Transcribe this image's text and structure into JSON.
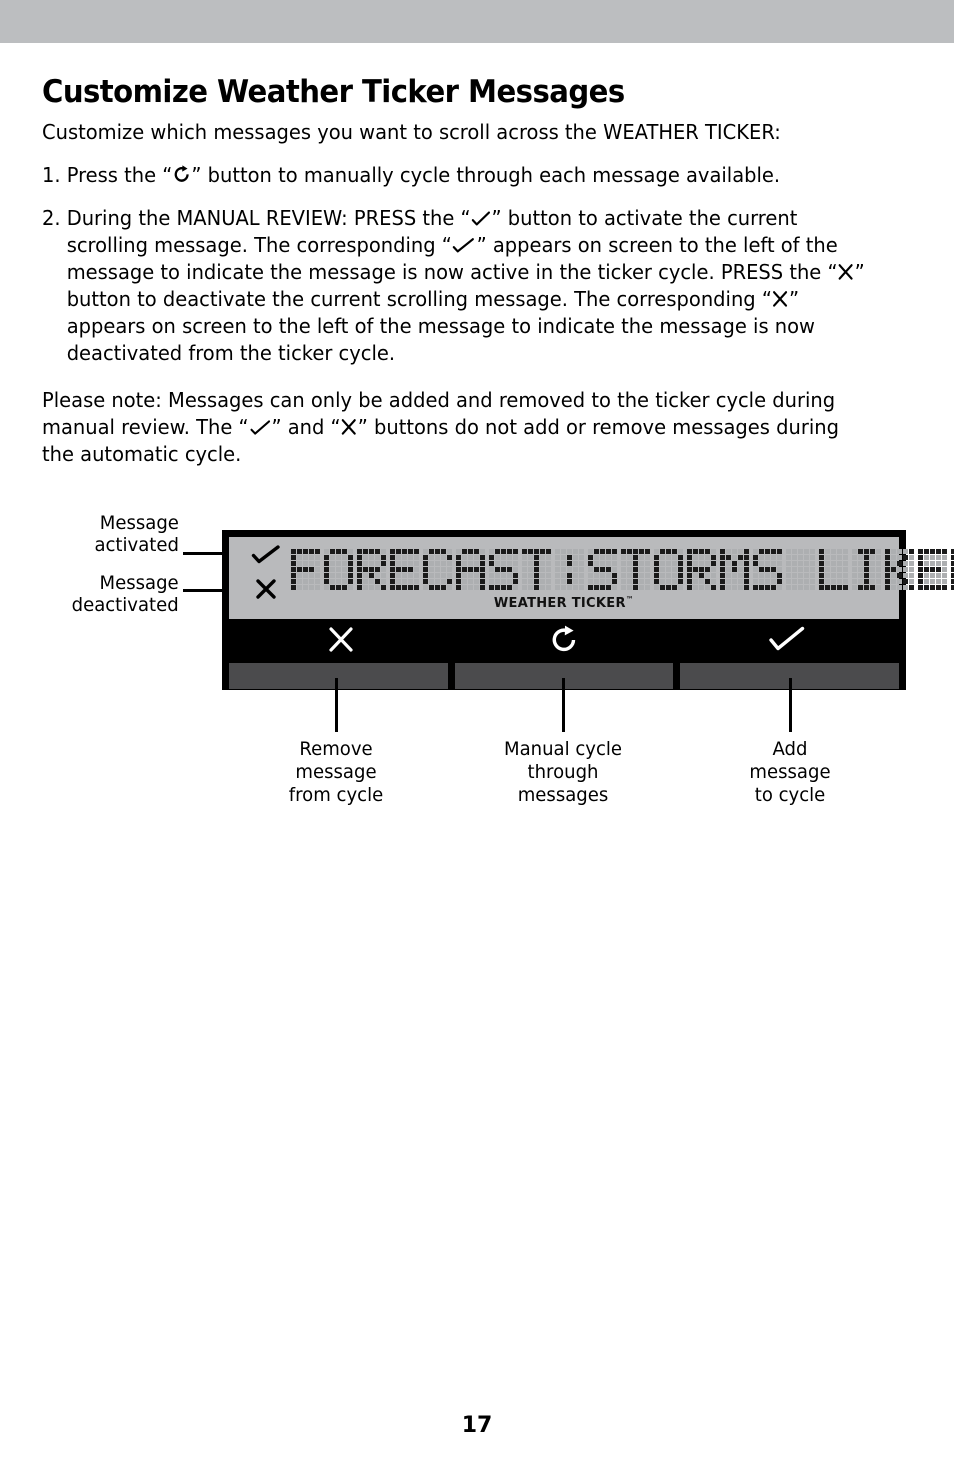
{
  "page": {
    "number": "17",
    "title": "Customize Weather Ticker Messages",
    "intro": "Customize which messages you want to scroll across the WEATHER TICKER:"
  },
  "steps": [
    {
      "number": "1.",
      "text_before": "Press the “",
      "icon": "cycle-icon",
      "text_after": "” button to manually cycle through each message available."
    },
    {
      "number": "2.",
      "seg1": "During the MANUAL REVIEW: PRESS the “",
      "icon1": "check-icon",
      "seg2": "” button to activate the current scrolling message. The corresponding “",
      "icon2": "check-icon",
      "seg3": "” appears on screen to the left of the message to indicate the message is now active in the ticker cycle. PRESS the “",
      "icon3": "x-icon",
      "seg4": "” button to deactivate the current scrolling message. The corresponding “",
      "icon4": "x-icon",
      "seg5": "” appears on screen to the left of the message to indicate the message is now deactivated from the ticker cycle."
    }
  ],
  "note": {
    "seg1": "Please note: Messages can only be added and removed to the ticker cycle during manual review. The “",
    "icon1": "check-icon",
    "seg2": "” and “",
    "icon2": "x-icon",
    "seg3": "” buttons do not add or remove messages during the automatic cycle."
  },
  "diagram": {
    "left_labels": [
      {
        "line1": "Message",
        "line2": "activated",
        "icon": "check-icon"
      },
      {
        "line1": "Message",
        "line2": "deactivated",
        "icon": "x-icon"
      }
    ],
    "lcd": {
      "message": "FORECAST:STORMS LIKELY",
      "brand": "WEATHER TICKER",
      "brand_mark": "™",
      "indicator_active": "check-icon",
      "indicator_inactive": "x-icon"
    },
    "buttons": [
      {
        "icon": "x-icon",
        "label_line1": "Remove",
        "label_line2": "message",
        "label_line3": "from cycle"
      },
      {
        "icon": "cycle-icon",
        "label_line1": "Manual cycle",
        "label_line2": "through",
        "label_line3": "messages"
      },
      {
        "icon": "check-icon",
        "label_line1": "Add",
        "label_line2": "message",
        "label_line3": "to cycle"
      }
    ]
  },
  "colors": {
    "top_band": "#bcbec0",
    "lcd_background": "#b9babc",
    "device_body": "#000000",
    "button_face": "#4b4b4d",
    "dot_on": "#1a1a1a",
    "dot_off": "#adafb1"
  }
}
